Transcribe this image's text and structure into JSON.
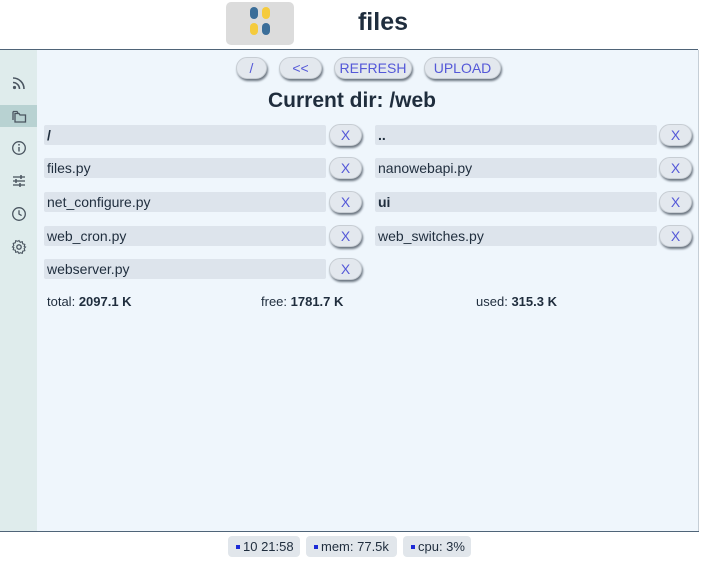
{
  "header": {
    "title": "files",
    "logo_colors": [
      "#3b6e99",
      "#f5cb3d"
    ]
  },
  "sidebar": {
    "items": [
      {
        "icon": "rss-icon",
        "active": false
      },
      {
        "icon": "files-icon",
        "active": true
      },
      {
        "icon": "info-icon",
        "active": false
      },
      {
        "icon": "sliders-icon",
        "active": false
      },
      {
        "icon": "clock-icon",
        "active": false
      },
      {
        "icon": "gear-icon",
        "active": false
      }
    ]
  },
  "toolbar": {
    "root_label": "/",
    "back_label": "<<",
    "refresh_label": "REFRESH",
    "upload_label": "UPLOAD"
  },
  "current_dir": "Current dir: /web",
  "files": [
    {
      "name": "/",
      "dir": true
    },
    {
      "name": "..",
      "dir": false
    },
    {
      "name": "files.py",
      "dir": false
    },
    {
      "name": "nanowebapi.py",
      "dir": false
    },
    {
      "name": "net_configure.py",
      "dir": false
    },
    {
      "name": "ui",
      "dir": true
    },
    {
      "name": "web_cron.py",
      "dir": false
    },
    {
      "name": "web_switches.py",
      "dir": false
    },
    {
      "name": "webserver.py",
      "dir": false
    }
  ],
  "delete_label": "X",
  "stats": {
    "total_label": "total:",
    "total_value": "2097.1 K",
    "free_label": "free:",
    "free_value": "1781.7 K",
    "used_label": "used:",
    "used_value": "315.3 K"
  },
  "footer": {
    "time": "10 21:58",
    "mem": "mem: 77.5k",
    "cpu": "cpu: 3%"
  },
  "colors": {
    "accent": "#5458d8",
    "main_bg": "#eff6fc",
    "sidebar_bg": "#dfecec"
  }
}
